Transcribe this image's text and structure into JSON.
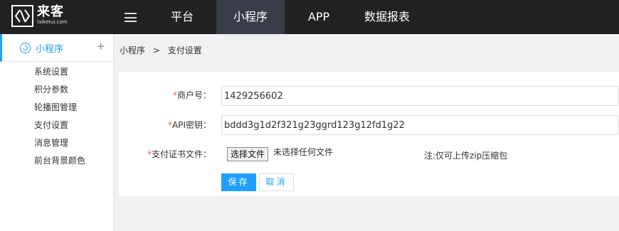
{
  "brand": {
    "name_cn": "来客",
    "name_en": "laiketui.com"
  },
  "topnav": {
    "items": [
      {
        "label": "平台"
      },
      {
        "label": "小程序"
      },
      {
        "label": "APP"
      },
      {
        "label": "数据报表"
      }
    ]
  },
  "sidebar": {
    "section_title": "小程序",
    "add_symbol": "+",
    "items": [
      {
        "label": "系统设置"
      },
      {
        "label": "积分参数"
      },
      {
        "label": "轮播图管理"
      },
      {
        "label": "支付设置"
      },
      {
        "label": "消息管理"
      },
      {
        "label": "前台背景颜色"
      }
    ]
  },
  "breadcrumb": {
    "parent": "小程序",
    "separator": ">",
    "current": "支付设置"
  },
  "form": {
    "required_mark": "*",
    "merchant_label": "商户号：",
    "merchant_value": "1429256602",
    "api_key_label": "API密钥：",
    "api_key_value": "bddd3g1d2f321g23ggrd123g12fd1g22",
    "cert_label": "支付证书文件：",
    "cert_button": "选择文件",
    "cert_status": "未选择任何文件",
    "cert_note": "注:仅可上传zip压缩包",
    "save_label": "保存",
    "cancel_label": "取消"
  },
  "colors": {
    "topbar": "#222222",
    "accent": "#1E9FFF",
    "required": "#FF5722",
    "active_nav": "#393D49"
  }
}
